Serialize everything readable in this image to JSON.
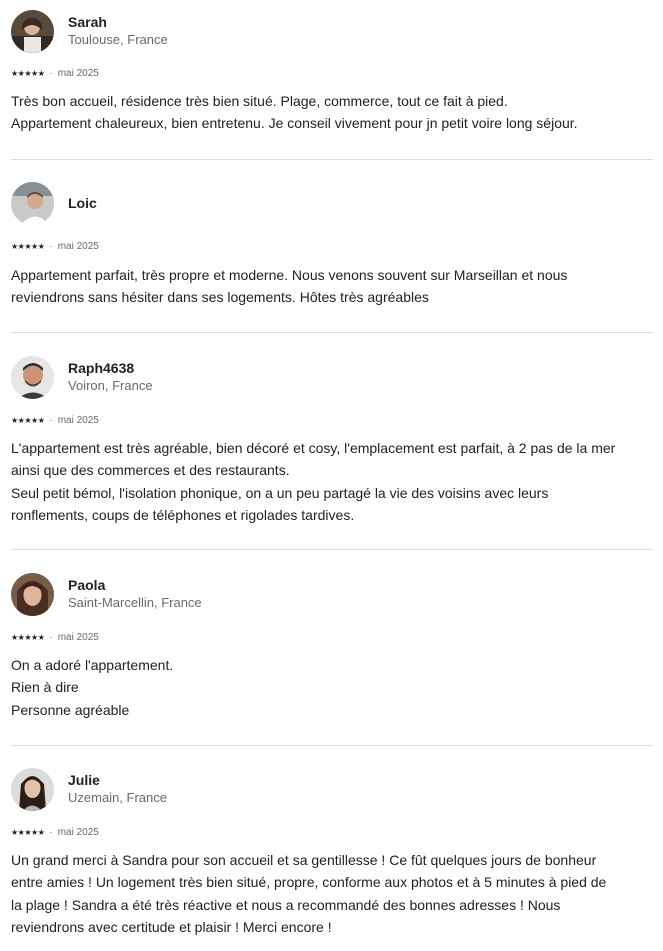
{
  "reviews": [
    {
      "name": "Sarah",
      "location": "Toulouse, France",
      "stars": "★★★★★",
      "date": "mai 2025",
      "lines": [
        "Très bon accueil, résidence très bien situé. Plage, commerce, tout ce fait à pied.",
        "Appartement chaleureux, bien entretenu. Je conseil vivement pour jn petit voire long séjour."
      ]
    },
    {
      "name": "Loic",
      "location": "",
      "stars": "★★★★★",
      "date": "mai 2025",
      "lines": [
        "Appartement parfait, très propre et moderne. Nous venons souvent sur Marseillan et nous",
        "reviendrons sans hésiter dans ses logements. Hôtes très agréables"
      ]
    },
    {
      "name": "Raph4638",
      "location": "Voiron, France",
      "stars": "★★★★★",
      "date": "mai 2025",
      "lines": [
        "L'appartement est très agréable, bien décoré et cosy, l'emplacement est parfait, à 2 pas de la mer",
        "ainsi que des commerces et des restaurants.",
        "Seul petit bémol, l'isolation phonique, on a un peu partagé la vie des voisins avec leurs",
        "ronflements, coups de téléphones et rigolades tardives."
      ]
    },
    {
      "name": "Paola",
      "location": "Saint-Marcellin, France",
      "stars": "★★★★★",
      "date": "mai 2025",
      "lines": [
        "On a adoré l'appartement.",
        "Rien à dire",
        "Personne agréable"
      ]
    },
    {
      "name": "Julie",
      "location": "Uzemain, France",
      "stars": "★★★★★",
      "date": "mai 2025",
      "lines": [
        "Un grand merci à Sandra pour son accueil et sa gentillesse ! Ce fût quelques jours de bonheur",
        "entre amies ! Un logement très bien situé, propre, conforme aux photos et à 5 minutes à pied de",
        "la plage ! Sandra a été très réactive et nous a recommandé des bonnes adresses ! Nous",
        "reviendrons avec certitude et plaisir ! Merci encore !"
      ]
    }
  ]
}
